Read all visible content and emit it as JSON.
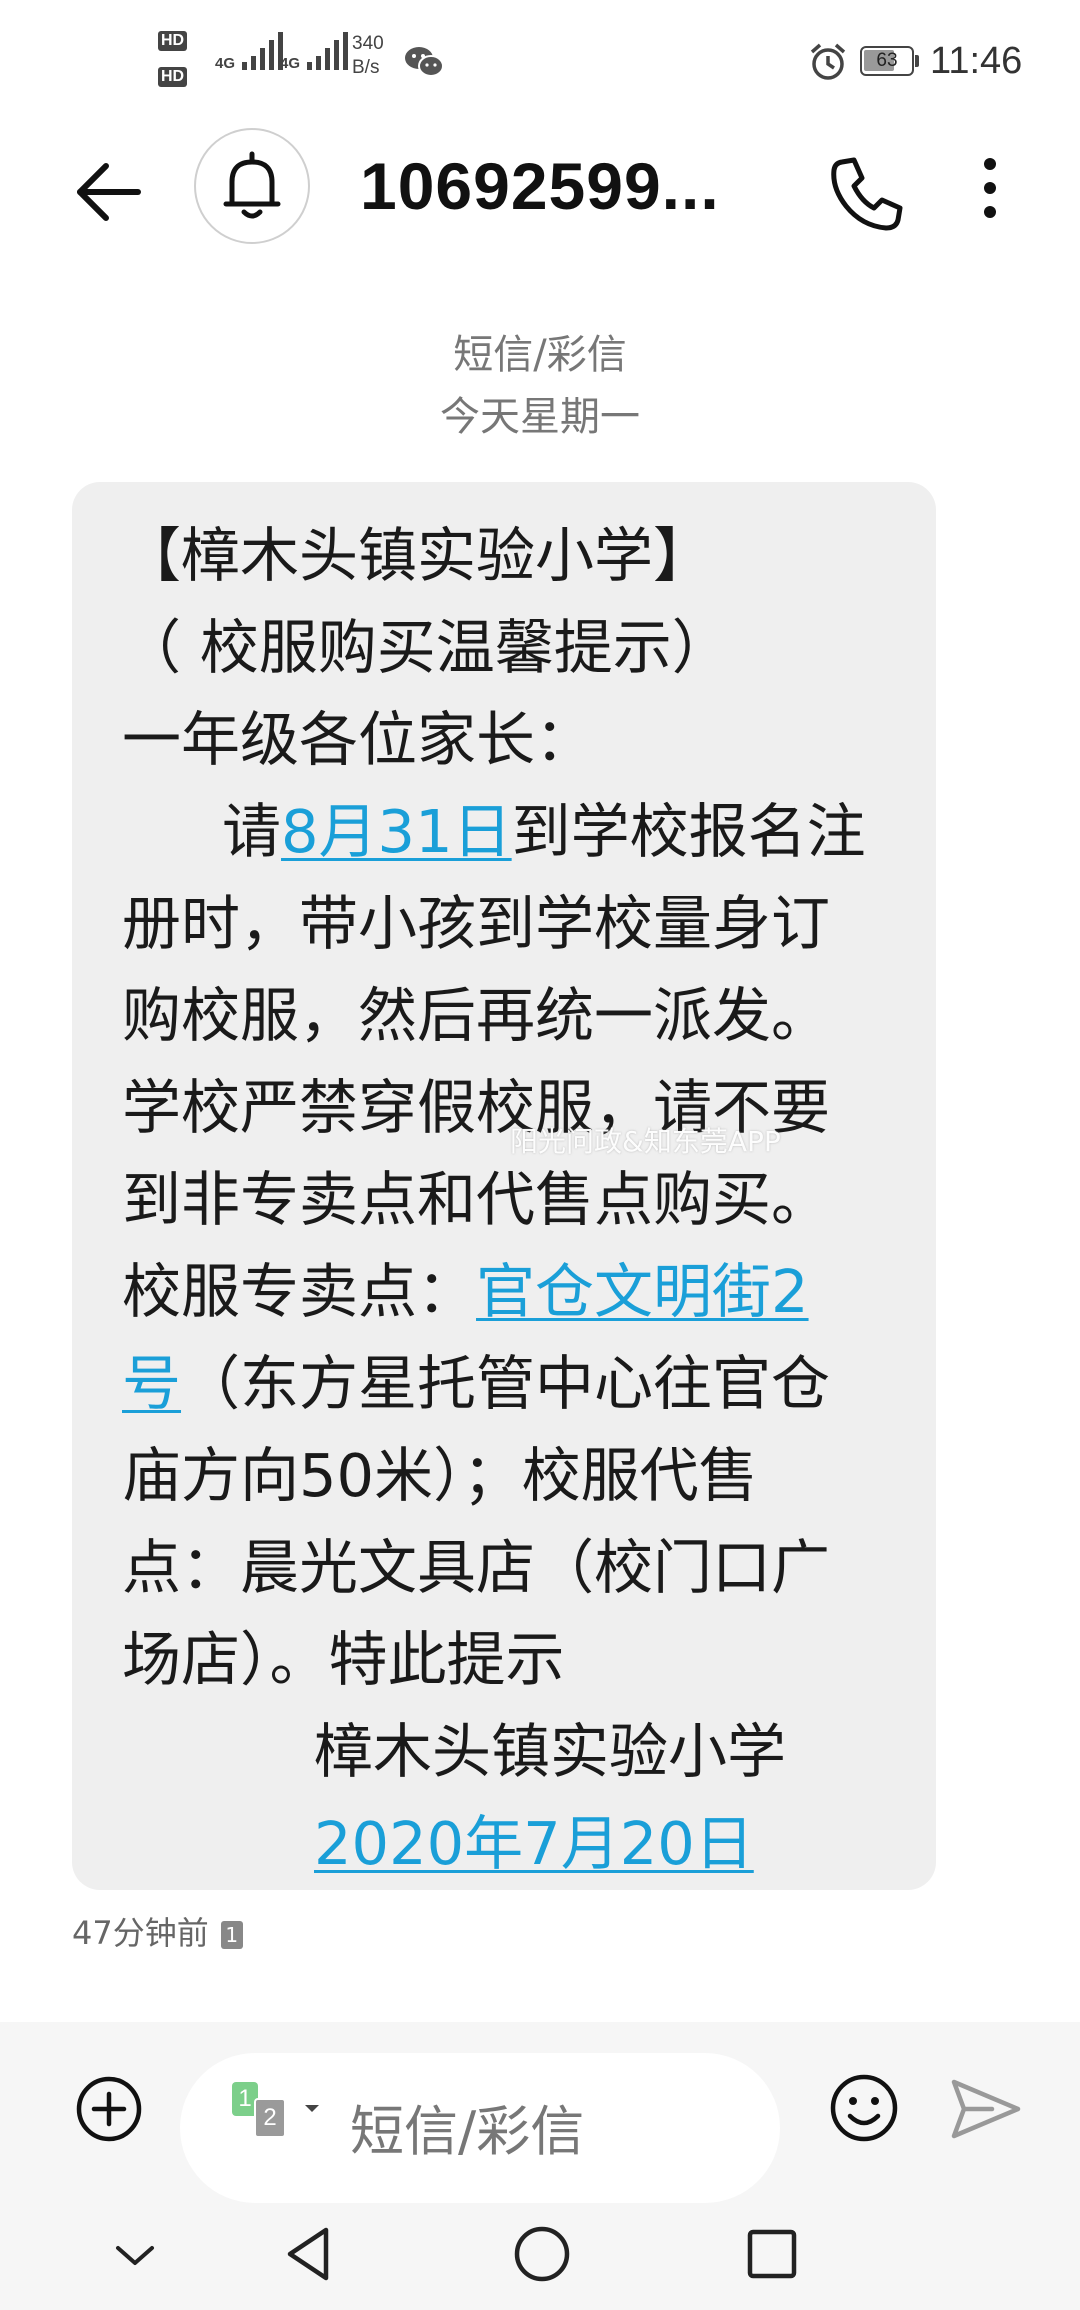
{
  "status_bar": {
    "hd1": "HD",
    "hd2": "HD",
    "sim1_network": "4G",
    "sim2_network": "4G",
    "speed_value": "340",
    "speed_unit": "B/s",
    "battery": "63",
    "time": "11:46"
  },
  "header": {
    "title": "10692599..."
  },
  "conversation": {
    "type_label": "短信/彩信",
    "date_label": "今天星期一"
  },
  "message": {
    "line1": "【樟木头镇实验小学】",
    "line2": "（ 校服购买温馨提示）",
    "line3": "一年级各位家长：",
    "line4_pre": "请",
    "line4_link": "8月31日",
    "line4_post": "到学校报名注",
    "line5": "册时，带小孩到学校量身订",
    "line6": "购校服，然后再统一派发。",
    "line7": "学校严禁穿假校服，请不要",
    "line8": "到非专卖点和代售点购买。",
    "line9_pre": "校服专卖点：",
    "line9_link": "官仓文明街2",
    "line10_link": "号",
    "line10_post": "（东方星托管中心往官仓",
    "line11": "庙方向50米）；校服代售",
    "line12": "点：晨光文具店（校门口广",
    "line13": "场店）。特此提示",
    "signature": "樟木头镇实验小学",
    "date_link": "2020年7月20日",
    "watermark": "阳光问政&知东莞APP"
  },
  "timestamp": {
    "text": "47分钟前",
    "sim": "1"
  },
  "composer": {
    "sim1": "1",
    "sim2": "2",
    "placeholder": "短信/彩信"
  },
  "colors": {
    "link": "#1a9fd8",
    "bubble": "#efefef",
    "sim1_badge": "#7ccf8a",
    "sim2_badge": "#9a9a9a"
  },
  "icons": [
    "back-arrow-icon",
    "bell-icon",
    "phone-icon",
    "more-vert-icon",
    "add-icon",
    "sim-select-icon",
    "emoji-icon",
    "send-icon",
    "nav-hide-icon",
    "nav-back-icon",
    "nav-home-icon",
    "nav-recent-icon",
    "alarm-icon",
    "battery-icon",
    "wechat-icon",
    "signal-icon"
  ]
}
